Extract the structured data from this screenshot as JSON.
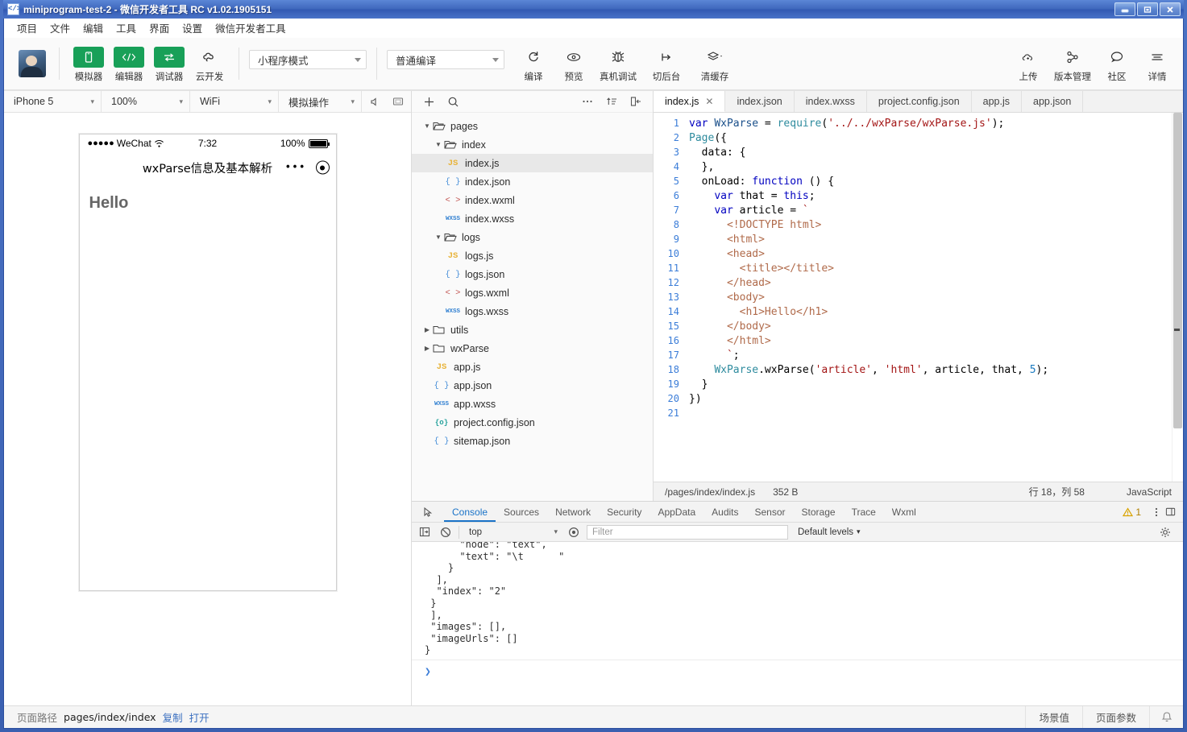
{
  "window": {
    "title": "miniprogram-test-2 - 微信开发者工具 RC v1.02.1905151",
    "icon": "code-brackets-icon",
    "minimize": "—",
    "restore": "❐",
    "close": "✕"
  },
  "menubar": {
    "items": [
      {
        "label": "项目",
        "name": "menu-project"
      },
      {
        "label": "文件",
        "name": "menu-file"
      },
      {
        "label": "编辑",
        "name": "menu-edit"
      },
      {
        "label": "工具",
        "name": "menu-tools"
      },
      {
        "label": "界面",
        "name": "menu-view"
      },
      {
        "label": "设置",
        "name": "menu-settings"
      },
      {
        "label": "微信开发者工具",
        "name": "menu-devtools"
      }
    ]
  },
  "toolbar": {
    "left_buttons": [
      {
        "label": "模拟器",
        "icon": "phone-icon",
        "style": "green"
      },
      {
        "label": "编辑器",
        "icon": "code-icon",
        "style": "green"
      },
      {
        "label": "调试器",
        "icon": "debug-toggle-icon",
        "style": "green"
      },
      {
        "label": "云开发",
        "icon": "cloud-icon",
        "style": "plain"
      }
    ],
    "mode_select": {
      "value": "小程序模式"
    },
    "compile_select": {
      "value": "普通编译"
    },
    "mid_buttons": [
      {
        "label": "编译",
        "icon": "refresh-icon"
      },
      {
        "label": "预览",
        "icon": "eye-icon"
      },
      {
        "label": "真机调试",
        "icon": "bug-icon"
      },
      {
        "label": "切后台",
        "icon": "background-icon"
      },
      {
        "label": "清缓存",
        "icon": "layers-icon"
      }
    ],
    "right_buttons": [
      {
        "label": "上传",
        "icon": "upload-cloud-icon"
      },
      {
        "label": "版本管理",
        "icon": "branch-icon"
      },
      {
        "label": "社区",
        "icon": "chat-icon"
      },
      {
        "label": "详情",
        "icon": "menu-lines-icon"
      }
    ]
  },
  "simulator": {
    "device": "iPhone 5",
    "zoom": "100%",
    "network": "WiFi",
    "action": "模拟操作",
    "mute_icon": "mute-icon",
    "screen_icon": "screen-icon",
    "phone": {
      "status": {
        "carrier_dots": "●●●●●",
        "carrier": "WeChat",
        "wifi_icon": "wifi-icon",
        "time": "7:32",
        "battery_percent": "100%"
      },
      "nav_title": "wxParse信息及基本解析",
      "capsule_dots": "•••",
      "capsule_circle_icon": "target-circle-icon",
      "heading": "Hello"
    }
  },
  "filetree": {
    "toolbar": [
      {
        "icon": "plus-icon",
        "name": "new-file-button"
      },
      {
        "icon": "search-icon",
        "name": "search-files-button"
      },
      {
        "icon": "more-icon",
        "name": "more-options-button"
      },
      {
        "icon": "sort-icon",
        "name": "sort-button"
      },
      {
        "icon": "collapse-icon",
        "name": "collapse-all-button"
      }
    ],
    "nodes": [
      {
        "label": "pages",
        "type": "folder",
        "depth": 0,
        "expanded": true,
        "selected": false
      },
      {
        "label": "index",
        "type": "folder",
        "depth": 1,
        "expanded": true,
        "selected": false
      },
      {
        "label": "index.js",
        "type": "js",
        "depth": 2,
        "selected": true
      },
      {
        "label": "index.json",
        "type": "json",
        "depth": 2,
        "selected": false
      },
      {
        "label": "index.wxml",
        "type": "wxml",
        "depth": 2,
        "selected": false
      },
      {
        "label": "index.wxss",
        "type": "wxss",
        "depth": 2,
        "selected": false
      },
      {
        "label": "logs",
        "type": "folder",
        "depth": 1,
        "expanded": true,
        "selected": false
      },
      {
        "label": "logs.js",
        "type": "js",
        "depth": 2,
        "selected": false
      },
      {
        "label": "logs.json",
        "type": "json",
        "depth": 2,
        "selected": false
      },
      {
        "label": "logs.wxml",
        "type": "wxml",
        "depth": 2,
        "selected": false
      },
      {
        "label": "logs.wxss",
        "type": "wxss",
        "depth": 2,
        "selected": false
      },
      {
        "label": "utils",
        "type": "folder",
        "depth": 0,
        "expanded": false,
        "selected": false
      },
      {
        "label": "wxParse",
        "type": "folder",
        "depth": 0,
        "expanded": false,
        "selected": false
      },
      {
        "label": "app.js",
        "type": "js",
        "depth": 1,
        "selected": false
      },
      {
        "label": "app.json",
        "type": "json",
        "depth": 1,
        "selected": false
      },
      {
        "label": "app.wxss",
        "type": "wxss",
        "depth": 1,
        "selected": false
      },
      {
        "label": "project.config.json",
        "type": "cfg",
        "depth": 1,
        "selected": false
      },
      {
        "label": "sitemap.json",
        "type": "json",
        "depth": 1,
        "selected": false
      }
    ]
  },
  "editor": {
    "tabs": [
      {
        "label": "index.js",
        "active": true,
        "closable": true
      },
      {
        "label": "index.json",
        "active": false
      },
      {
        "label": "index.wxss",
        "active": false
      },
      {
        "label": "project.config.json",
        "active": false
      },
      {
        "label": "app.js",
        "active": false
      },
      {
        "label": "app.json",
        "active": false
      }
    ],
    "close_glyph": "✕",
    "lines": [
      {
        "n": "1",
        "tokens": [
          {
            "t": "var ",
            "c": "kw"
          },
          {
            "t": "WxParse",
            "c": "ident"
          },
          {
            "t": " = ",
            "c": "punct"
          },
          {
            "t": "require",
            "c": "fn"
          },
          {
            "t": "(",
            "c": "punct"
          },
          {
            "t": "'../../wxParse/wxParse.js'",
            "c": "str"
          },
          {
            "t": ");",
            "c": "punct"
          }
        ]
      },
      {
        "n": "2",
        "tokens": [
          {
            "t": "Page",
            "c": "fn"
          },
          {
            "t": "({",
            "c": "punct"
          }
        ]
      },
      {
        "n": "3",
        "tokens": [
          {
            "t": "  data: {",
            "c": "punct"
          }
        ]
      },
      {
        "n": "4",
        "tokens": [
          {
            "t": "  },",
            "c": "punct"
          }
        ]
      },
      {
        "n": "5",
        "tokens": [
          {
            "t": "  onLoad: ",
            "c": "punct"
          },
          {
            "t": "function",
            "c": "kw"
          },
          {
            "t": " () {",
            "c": "punct"
          }
        ]
      },
      {
        "n": "6",
        "tokens": [
          {
            "t": "    ",
            "c": "punct"
          },
          {
            "t": "var",
            "c": "kw"
          },
          {
            "t": " that = ",
            "c": "punct"
          },
          {
            "t": "this",
            "c": "kw"
          },
          {
            "t": ";",
            "c": "punct"
          }
        ]
      },
      {
        "n": "7",
        "tokens": [
          {
            "t": "    ",
            "c": "punct"
          },
          {
            "t": "var",
            "c": "kw"
          },
          {
            "t": " article = ",
            "c": "punct"
          },
          {
            "t": "`",
            "c": "str"
          }
        ]
      },
      {
        "n": "8",
        "tokens": [
          {
            "t": "      <!DOCTYPE html>",
            "c": "tag"
          }
        ]
      },
      {
        "n": "9",
        "tokens": [
          {
            "t": "      <html>",
            "c": "tag"
          }
        ]
      },
      {
        "n": "10",
        "tokens": [
          {
            "t": "      <head>",
            "c": "tag"
          }
        ]
      },
      {
        "n": "11",
        "tokens": [
          {
            "t": "        <title></title>",
            "c": "tag"
          }
        ]
      },
      {
        "n": "12",
        "tokens": [
          {
            "t": "      </head>",
            "c": "tag"
          }
        ]
      },
      {
        "n": "13",
        "tokens": [
          {
            "t": "      <body>",
            "c": "tag"
          }
        ]
      },
      {
        "n": "14",
        "tokens": [
          {
            "t": "        <h1>Hello</h1>",
            "c": "tag"
          }
        ]
      },
      {
        "n": "15",
        "tokens": [
          {
            "t": "      </body>",
            "c": "tag"
          }
        ]
      },
      {
        "n": "16",
        "tokens": [
          {
            "t": "      </html>",
            "c": "tag"
          }
        ]
      },
      {
        "n": "17",
        "tokens": [
          {
            "t": "      `",
            "c": "str"
          },
          {
            "t": ";",
            "c": "punct"
          }
        ]
      },
      {
        "n": "18",
        "tokens": [
          {
            "t": "    ",
            "c": "punct"
          },
          {
            "t": "WxParse",
            "c": "fn"
          },
          {
            "t": ".wxParse(",
            "c": "punct"
          },
          {
            "t": "'article'",
            "c": "str"
          },
          {
            "t": ", ",
            "c": "punct"
          },
          {
            "t": "'html'",
            "c": "str"
          },
          {
            "t": ", article, that, ",
            "c": "punct"
          },
          {
            "t": "5",
            "c": "num"
          },
          {
            "t": ");",
            "c": "punct"
          }
        ]
      },
      {
        "n": "19",
        "tokens": [
          {
            "t": "  }",
            "c": "punct"
          }
        ]
      },
      {
        "n": "20",
        "tokens": [
          {
            "t": "})",
            "c": "punct"
          }
        ]
      },
      {
        "n": "21",
        "tokens": []
      }
    ],
    "status": {
      "path": "/pages/index/index.js",
      "size": "352 B",
      "cursor": "行 18，列 58",
      "language": "JavaScript"
    }
  },
  "devtools": {
    "inspect_icon": "inspect-element-icon",
    "tabs": [
      {
        "label": "Console",
        "active": true
      },
      {
        "label": "Sources",
        "active": false
      },
      {
        "label": "Network",
        "active": false
      },
      {
        "label": "Security",
        "active": false
      },
      {
        "label": "AppData",
        "active": false
      },
      {
        "label": "Audits",
        "active": false
      },
      {
        "label": "Sensor",
        "active": false
      },
      {
        "label": "Storage",
        "active": false
      },
      {
        "label": "Trace",
        "active": false
      },
      {
        "label": "Wxml",
        "active": false
      }
    ],
    "warning_count": "1",
    "warning_icon": "warning-triangle-icon",
    "more_icon": "kebab-menu-icon",
    "dock_icon": "dock-panel-icon",
    "console_toolbar": {
      "sidebar_icon": "console-sidebar-icon",
      "clear_icon": "clear-console-icon",
      "context": "top",
      "eye_icon": "live-expression-icon",
      "filter_placeholder": "Filter",
      "levels": "Default levels",
      "settings_icon": "gear-icon"
    },
    "console_output": [
      "      \"node\": \"text\",",
      "      \"text\": \"\\t      \"",
      "    }",
      "  ],",
      "  \"index\": \"2\"",
      " }",
      " ],",
      " \"images\": [],",
      " \"imageUrls\": []",
      "}"
    ],
    "prompt": "❯"
  },
  "bottombar": {
    "path_label": "页面路径",
    "path_value": "pages/index/index",
    "copy_label": "复制",
    "open_label": "打开",
    "scene_label": "场景值",
    "params_label": "页面参数",
    "bell_icon": "bell-icon"
  },
  "colors": {
    "accent_green": "#18a058",
    "title_blue": "#3f68bd",
    "link_blue": "#3a6fc0",
    "devtools_active": "#1a73c8"
  }
}
